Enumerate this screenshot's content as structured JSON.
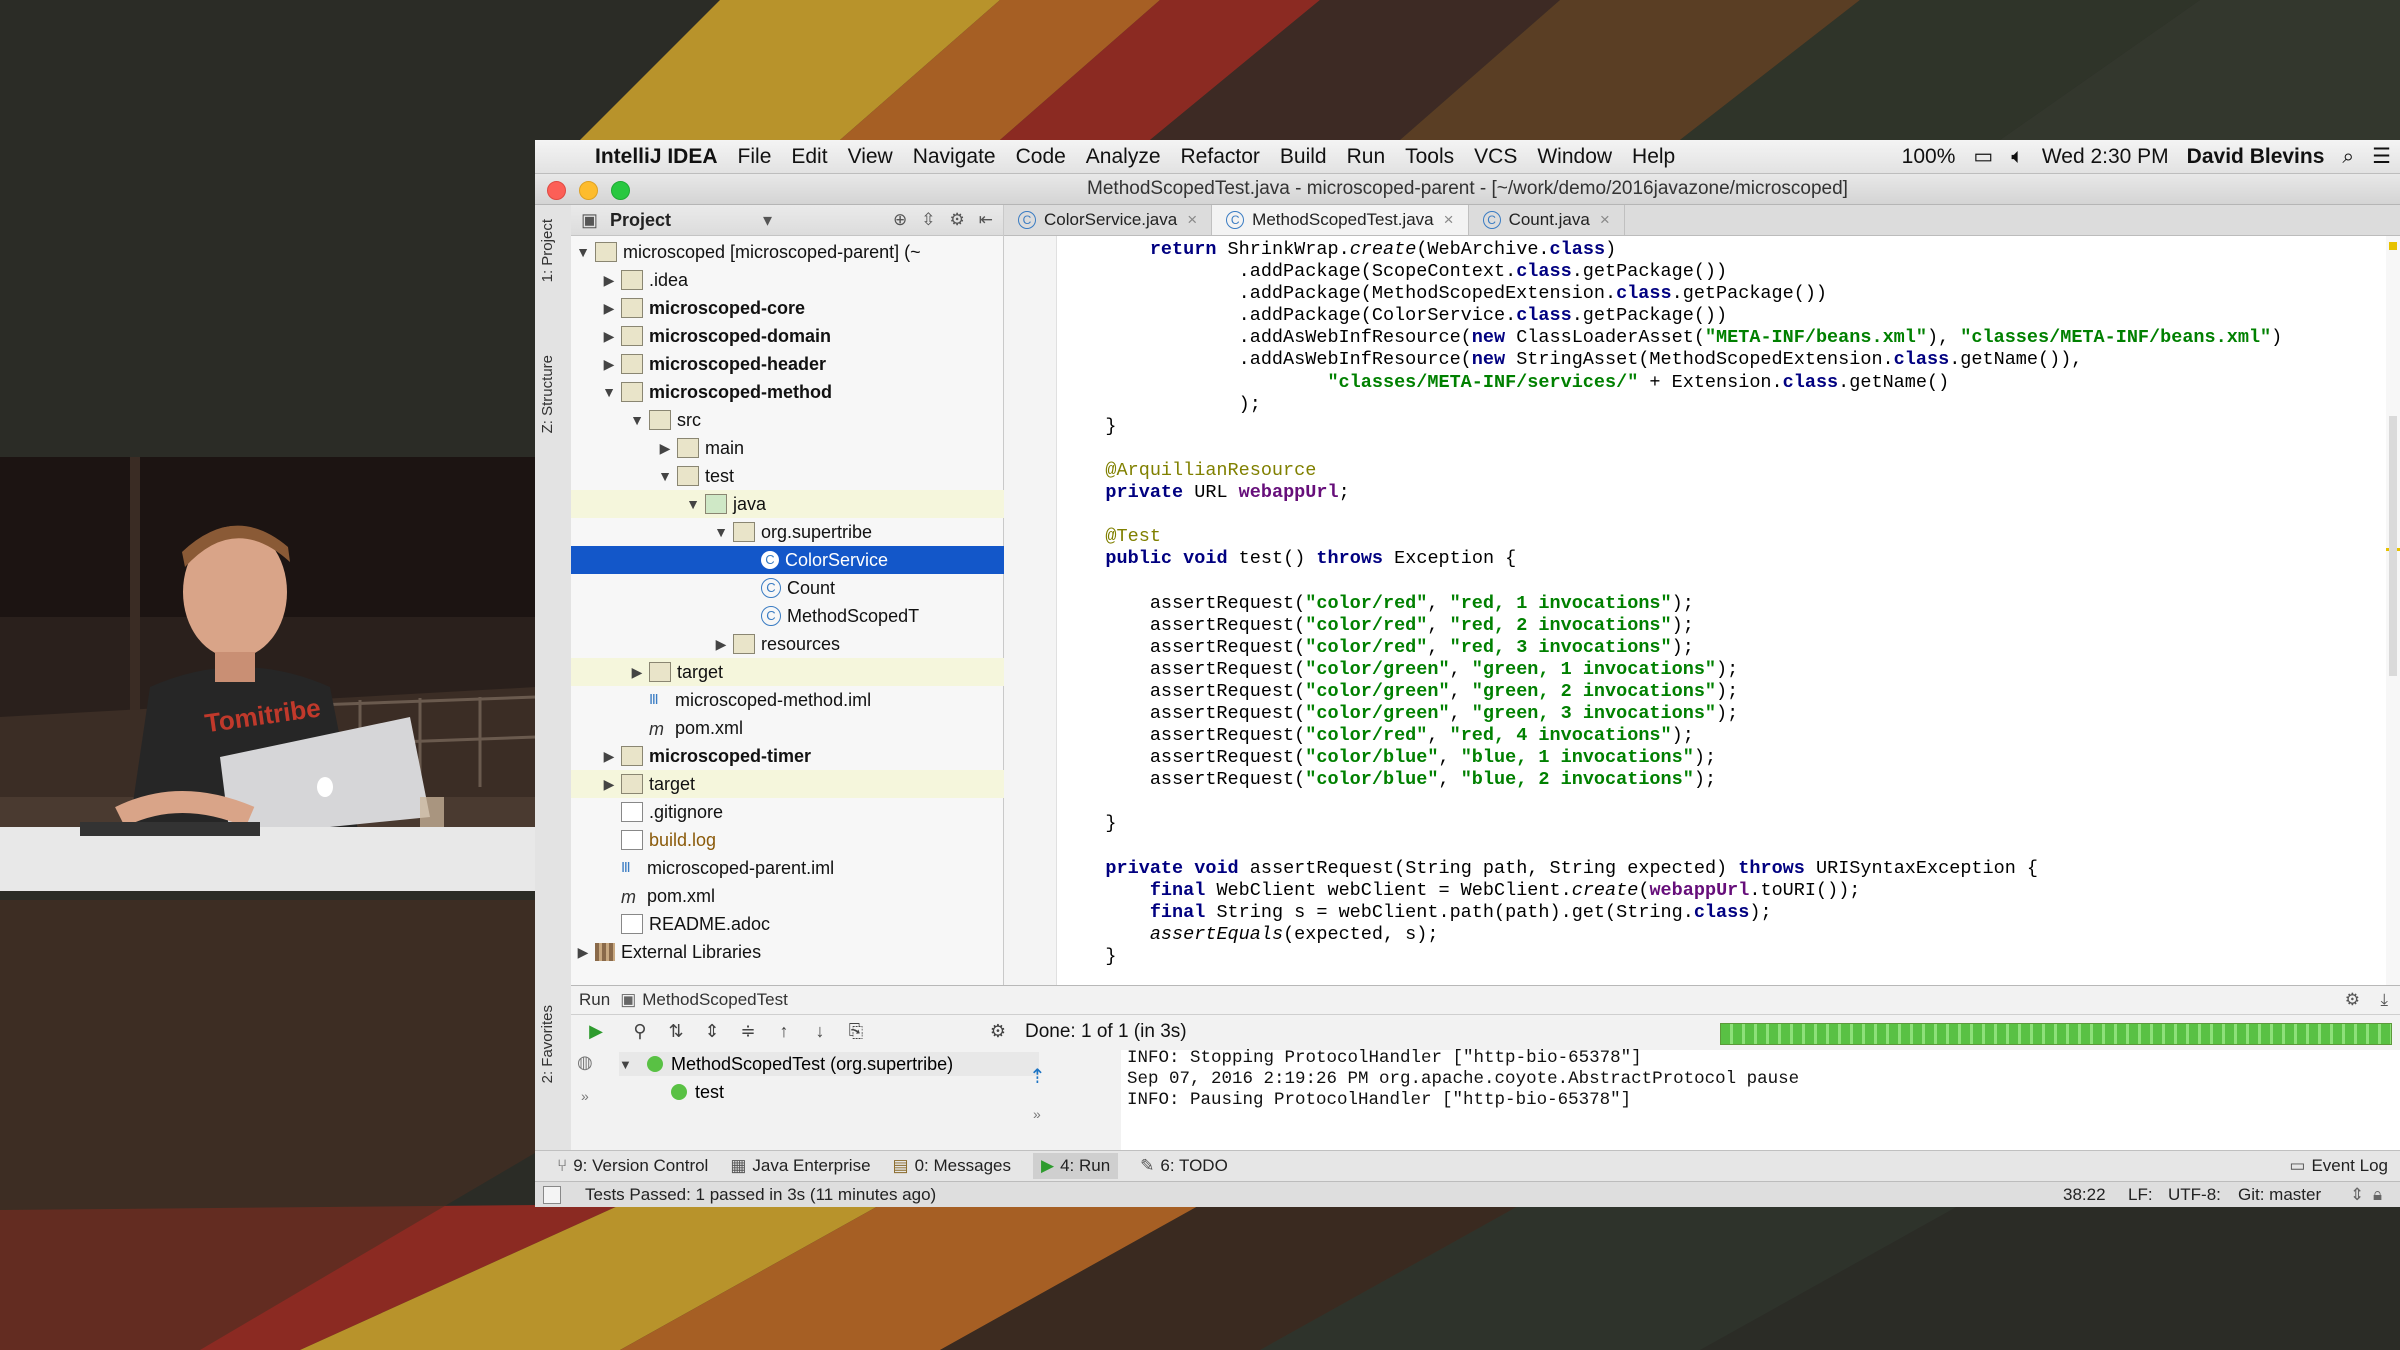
{
  "colors": {
    "accent": "#1357c9",
    "progress": "#59c144",
    "stripe_gold": "#b8932b",
    "stripe_red": "#8b2a22"
  },
  "menubar": {
    "app": "IntelliJ IDEA",
    "items": [
      "File",
      "Edit",
      "View",
      "Navigate",
      "Code",
      "Analyze",
      "Refactor",
      "Build",
      "Run",
      "Tools",
      "VCS",
      "Window",
      "Help"
    ],
    "battery": "100%",
    "clock": "Wed 2:30 PM",
    "user": "David Blevins"
  },
  "window": {
    "title": "MethodScopedTest.java - microscoped-parent - [~/work/demo/2016javazone/microscoped]"
  },
  "sidebar_tabs": [
    "1: Project",
    "Z: Structure",
    "2: Favorites"
  ],
  "project": {
    "title": "Project",
    "tree": [
      {
        "label": "microscoped [microscoped-parent] (~",
        "bold": false
      },
      {
        "label": ".idea",
        "bold": false
      },
      {
        "label": "microscoped-core",
        "bold": true
      },
      {
        "label": "microscoped-domain",
        "bold": true
      },
      {
        "label": "microscoped-header",
        "bold": true
      },
      {
        "label": "microscoped-method",
        "bold": true
      },
      {
        "label": "src",
        "bold": false
      },
      {
        "label": "main",
        "bold": false
      },
      {
        "label": "test",
        "bold": false
      },
      {
        "label": "java",
        "bold": false
      },
      {
        "label": "org.supertribe",
        "bold": false
      },
      {
        "label": "ColorService",
        "bold": false
      },
      {
        "label": "Count",
        "bold": false
      },
      {
        "label": "MethodScopedT",
        "bold": false
      },
      {
        "label": "resources",
        "bold": false
      },
      {
        "label": "target",
        "bold": false
      },
      {
        "label": "microscoped-method.iml",
        "bold": false
      },
      {
        "label": "pom.xml",
        "bold": false
      },
      {
        "label": "microscoped-timer",
        "bold": true
      },
      {
        "label": "target",
        "bold": false
      },
      {
        "label": ".gitignore",
        "bold": false
      },
      {
        "label": "build.log",
        "bold": false
      },
      {
        "label": "microscoped-parent.iml",
        "bold": false
      },
      {
        "label": "pom.xml",
        "bold": false
      },
      {
        "label": "README.adoc",
        "bold": false
      },
      {
        "label": "External Libraries",
        "bold": false
      }
    ]
  },
  "tabs": [
    "ColorService.java",
    "MethodScopedTest.java",
    "Count.java"
  ],
  "code": [
    "        return ShrinkWrap.create(WebArchive.class)",
    "                .addPackage(ScopeContext.class.getPackage())",
    "                .addPackage(MethodScopedExtension.class.getPackage())",
    "                .addPackage(ColorService.class.getPackage())",
    "                .addAsWebInfResource(new ClassLoaderAsset(\"META-INF/beans.xml\"), \"classes/META-INF/beans.xml\")",
    "                .addAsWebInfResource(new StringAsset(MethodScopedExtension.class.getName()),",
    "                        \"classes/META-INF/services/\" + Extension.class.getName()",
    "                );",
    "    }",
    "",
    "    @ArquillianResource",
    "    private URL webappUrl;",
    "",
    "    @Test",
    "    public void test() throws Exception {",
    "",
    "        assertRequest(\"color/red\", \"red, 1 invocations\");",
    "        assertRequest(\"color/red\", \"red, 2 invocations\");",
    "        assertRequest(\"color/red\", \"red, 3 invocations\");",
    "        assertRequest(\"color/green\", \"green, 1 invocations\");",
    "        assertRequest(\"color/green\", \"green, 2 invocations\");",
    "        assertRequest(\"color/green\", \"green, 3 invocations\");",
    "        assertRequest(\"color/red\", \"red, 4 invocations\");",
    "        assertRequest(\"color/blue\", \"blue, 1 invocations\");",
    "        assertRequest(\"color/blue\", \"blue, 2 invocations\");",
    "",
    "    }",
    "",
    "    private void assertRequest(String path, String expected) throws URISyntaxException {",
    "        final WebClient webClient = WebClient.create(webappUrl.toURI());",
    "        final String s = webClient.path(path).get(String.class);",
    "        assertEquals(expected, s);",
    "    }"
  ],
  "run": {
    "label": "Run",
    "config": "MethodScopedTest",
    "status": "Done: 1 of 1 (in 3s)",
    "progress": 1.0,
    "tests": [
      "MethodScopedTest (org.supertribe)",
      "test"
    ],
    "console": [
      "INFO: Stopping ProtocolHandler [\"http-bio-65378\"]",
      "Sep 07, 2016 2:19:26 PM org.apache.coyote.AbstractProtocol pause",
      "INFO: Pausing ProtocolHandler [\"http-bio-65378\"]"
    ]
  },
  "bottom_tabs": [
    "9: Version Control",
    "Java Enterprise",
    "0: Messages",
    "4: Run",
    "6: TODO"
  ],
  "event_log": "Event Log",
  "status": {
    "message": "Tests Passed: 1 passed in 3s (11 minutes ago)",
    "position": "38:22",
    "line_sep": "LF:",
    "encoding": "UTF-8:",
    "git": "Git: master"
  },
  "shirt_text": "Tomitribe"
}
